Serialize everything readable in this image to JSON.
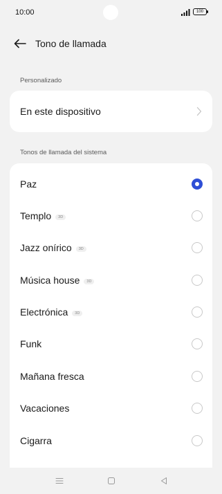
{
  "status_bar": {
    "time": "10:00",
    "battery": "100"
  },
  "header": {
    "back_icon": "arrow-left-icon",
    "title": "Tono de llamada"
  },
  "custom_section": {
    "label": "Personalizado",
    "device_item": {
      "label": "En este dispositivo",
      "icon": "chevron-right-icon"
    }
  },
  "system_section": {
    "label": "Tonos de llamada del sistema",
    "badge_text": "3D",
    "accent_color": "#2f4fd6",
    "tones": [
      {
        "name": "Paz",
        "badge": "",
        "selected": true
      },
      {
        "name": "Templo",
        "badge": "3D",
        "selected": false
      },
      {
        "name": "Jazz onírico",
        "badge": "3D",
        "selected": false
      },
      {
        "name": "Música house",
        "badge": "3D",
        "selected": false
      },
      {
        "name": "Electrónica",
        "badge": "3D",
        "selected": false
      },
      {
        "name": "Funk",
        "badge": "",
        "selected": false
      },
      {
        "name": "Mañana fresca",
        "badge": "",
        "selected": false
      },
      {
        "name": "Vacaciones",
        "badge": "",
        "selected": false
      },
      {
        "name": "Cigarra",
        "badge": "",
        "selected": false
      }
    ]
  },
  "nav_bar": {
    "items": [
      "menu-icon",
      "home-square-icon",
      "back-triangle-icon"
    ]
  }
}
